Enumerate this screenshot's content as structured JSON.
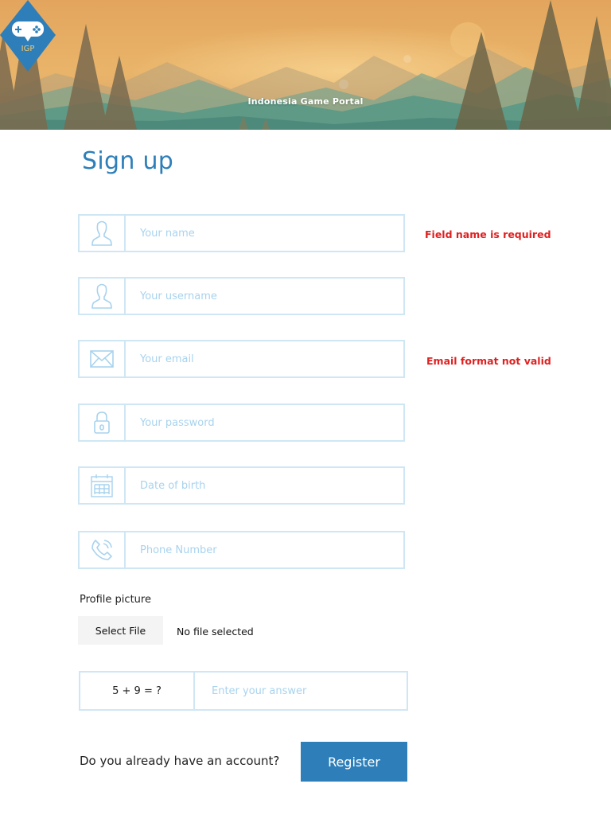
{
  "header": {
    "logo_text": "IGP",
    "site_name": "Indonesia Game Portal",
    "logo_color": "#2e7fb9"
  },
  "page_title": "Sign up",
  "fields": {
    "name": {
      "placeholder": "Your name",
      "icon": "user-icon",
      "value": ""
    },
    "username": {
      "placeholder": "Your username",
      "icon": "user-icon",
      "value": ""
    },
    "email": {
      "placeholder": "Your email",
      "icon": "envelope-icon",
      "value": ""
    },
    "password": {
      "placeholder": "Your password",
      "icon": "lock-icon",
      "value": ""
    },
    "dob": {
      "placeholder": "Date of birth",
      "icon": "calendar-icon",
      "value": ""
    },
    "phone": {
      "placeholder": "Phone Number",
      "icon": "phone-icon",
      "value": ""
    }
  },
  "errors": {
    "name": "Field name is required",
    "email": "Email format not valid",
    "color": "#e02020"
  },
  "profile": {
    "label": "Profile picture",
    "button": "Select File",
    "status": "No file selected"
  },
  "captcha": {
    "question": "5 + 9 = ?",
    "placeholder": "Enter your answer"
  },
  "footer": {
    "account_question": "Do you already have an account?",
    "register_label": "Register"
  },
  "colors": {
    "accent": "#2e7fb9",
    "border": "#cfe7f5",
    "placeholder": "#a8d3ee"
  }
}
